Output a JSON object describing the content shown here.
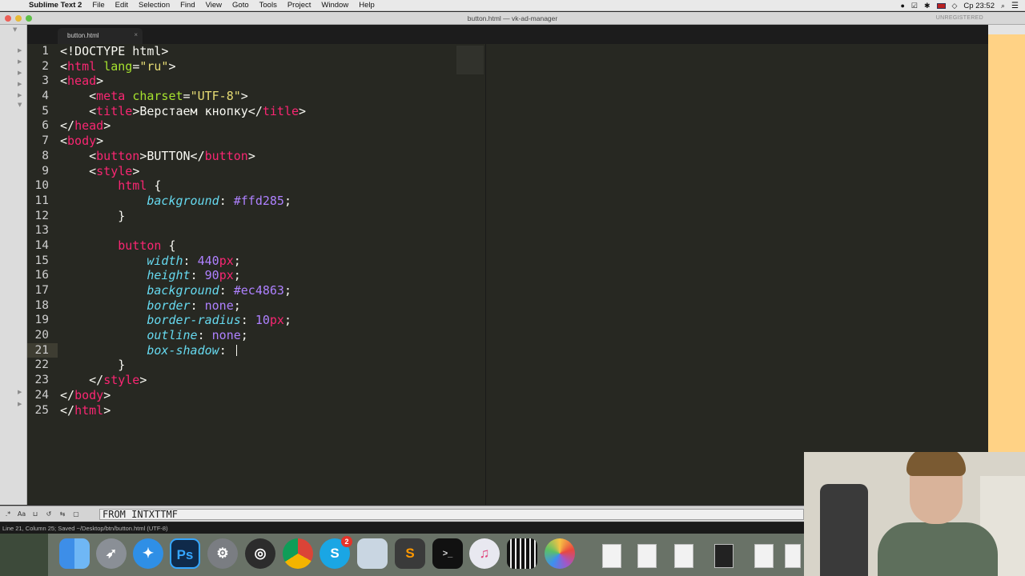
{
  "menubar": {
    "apple": "",
    "app_name": "Sublime Text 2",
    "items": [
      "File",
      "Edit",
      "Selection",
      "Find",
      "View",
      "Goto",
      "Tools",
      "Project",
      "Window",
      "Help"
    ],
    "clock": "Ср 23:52"
  },
  "window": {
    "title": "button.html — vk-ad-manager",
    "unregistered": "UNREGISTERED"
  },
  "tab": {
    "label": "button.html",
    "close": "×"
  },
  "editor": {
    "current_line": 21,
    "lines": [
      [
        [
          "t-plain",
          "<!DOCTYPE html>"
        ]
      ],
      [
        [
          "t-plain",
          "<"
        ],
        [
          "t-tag",
          "html"
        ],
        [
          "t-plain",
          " "
        ],
        [
          "t-attr",
          "lang"
        ],
        [
          "t-plain",
          "="
        ],
        [
          "t-str",
          "\"ru\""
        ],
        [
          "t-plain",
          ">"
        ]
      ],
      [
        [
          "t-plain",
          "<"
        ],
        [
          "t-tag",
          "head"
        ],
        [
          "t-plain",
          ">"
        ]
      ],
      [
        [
          "t-plain",
          "    <"
        ],
        [
          "t-tag",
          "meta"
        ],
        [
          "t-plain",
          " "
        ],
        [
          "t-attr",
          "charset"
        ],
        [
          "t-plain",
          "="
        ],
        [
          "t-str",
          "\"UTF-8\""
        ],
        [
          "t-plain",
          ">"
        ]
      ],
      [
        [
          "t-plain",
          "    <"
        ],
        [
          "t-tag",
          "title"
        ],
        [
          "t-plain",
          ">Верстаем кнопку</"
        ],
        [
          "t-tag",
          "title"
        ],
        [
          "t-plain",
          ">"
        ]
      ],
      [
        [
          "t-plain",
          "</"
        ],
        [
          "t-tag",
          "head"
        ],
        [
          "t-plain",
          ">"
        ]
      ],
      [
        [
          "t-plain",
          "<"
        ],
        [
          "t-tag",
          "body"
        ],
        [
          "t-plain",
          ">"
        ]
      ],
      [
        [
          "t-plain",
          "    <"
        ],
        [
          "t-tag",
          "button"
        ],
        [
          "t-plain",
          ">BUTTON</"
        ],
        [
          "t-tag",
          "button"
        ],
        [
          "t-plain",
          ">"
        ]
      ],
      [
        [
          "t-plain",
          "    <"
        ],
        [
          "t-tag",
          "style"
        ],
        [
          "t-plain",
          ">"
        ]
      ],
      [
        [
          "t-plain",
          "        "
        ],
        [
          "t-tag",
          "html"
        ],
        [
          "t-plain",
          " {"
        ]
      ],
      [
        [
          "t-plain",
          "            "
        ],
        [
          "t-prop",
          "background"
        ],
        [
          "t-plain",
          ": "
        ],
        [
          "t-num",
          "#ffd285"
        ],
        [
          "t-plain",
          ";"
        ]
      ],
      [
        [
          "t-plain",
          "        }"
        ]
      ],
      [
        [
          "t-plain",
          ""
        ]
      ],
      [
        [
          "t-plain",
          "        "
        ],
        [
          "t-tag",
          "button"
        ],
        [
          "t-plain",
          " {"
        ]
      ],
      [
        [
          "t-plain",
          "            "
        ],
        [
          "t-prop",
          "width"
        ],
        [
          "t-plain",
          ": "
        ],
        [
          "t-num",
          "440"
        ],
        [
          "t-tag",
          "px"
        ],
        [
          "t-plain",
          ";"
        ]
      ],
      [
        [
          "t-plain",
          "            "
        ],
        [
          "t-prop",
          "height"
        ],
        [
          "t-plain",
          ": "
        ],
        [
          "t-num",
          "90"
        ],
        [
          "t-tag",
          "px"
        ],
        [
          "t-plain",
          ";"
        ]
      ],
      [
        [
          "t-plain",
          "            "
        ],
        [
          "t-prop",
          "background"
        ],
        [
          "t-plain",
          ": "
        ],
        [
          "t-num",
          "#ec4863"
        ],
        [
          "t-plain",
          ";"
        ]
      ],
      [
        [
          "t-plain",
          "            "
        ],
        [
          "t-prop",
          "border"
        ],
        [
          "t-plain",
          ": "
        ],
        [
          "t-kw",
          "none"
        ],
        [
          "t-plain",
          ";"
        ]
      ],
      [
        [
          "t-plain",
          "            "
        ],
        [
          "t-prop",
          "border-radius"
        ],
        [
          "t-plain",
          ": "
        ],
        [
          "t-num",
          "10"
        ],
        [
          "t-tag",
          "px"
        ],
        [
          "t-plain",
          ";"
        ]
      ],
      [
        [
          "t-plain",
          "            "
        ],
        [
          "t-prop",
          "outline"
        ],
        [
          "t-plain",
          ": "
        ],
        [
          "t-kw",
          "none"
        ],
        [
          "t-plain",
          ";"
        ]
      ],
      [
        [
          "t-plain",
          "            "
        ],
        [
          "t-prop",
          "box-shadow"
        ],
        [
          "t-plain",
          ": "
        ]
      ],
      [
        [
          "t-plain",
          "        }"
        ]
      ],
      [
        [
          "t-plain",
          "    </"
        ],
        [
          "t-tag",
          "style"
        ],
        [
          "t-plain",
          ">"
        ]
      ],
      [
        [
          "t-plain",
          "</"
        ],
        [
          "t-tag",
          "body"
        ],
        [
          "t-plain",
          ">"
        ]
      ],
      [
        [
          "t-plain",
          "</"
        ],
        [
          "t-tag",
          "html"
        ],
        [
          "t-plain",
          ">"
        ]
      ]
    ]
  },
  "findbar": {
    "case_label": "Aa",
    "query": "FROM INTXTTMF"
  },
  "statusbar": {
    "text": "Line 21, Column 25; Saved ~/Desktop/btn/button.html (UTF-8)"
  },
  "dock": {
    "skype_badge": "2",
    "ps_label": "Ps",
    "skype_label": "S"
  },
  "colors": {
    "editor_bg": "#272822",
    "tag": "#f92672",
    "attr": "#a6e22e",
    "string": "#e6db74",
    "property": "#66d9ef",
    "number": "#ae81ff",
    "yellow_page": "#ffd285"
  }
}
